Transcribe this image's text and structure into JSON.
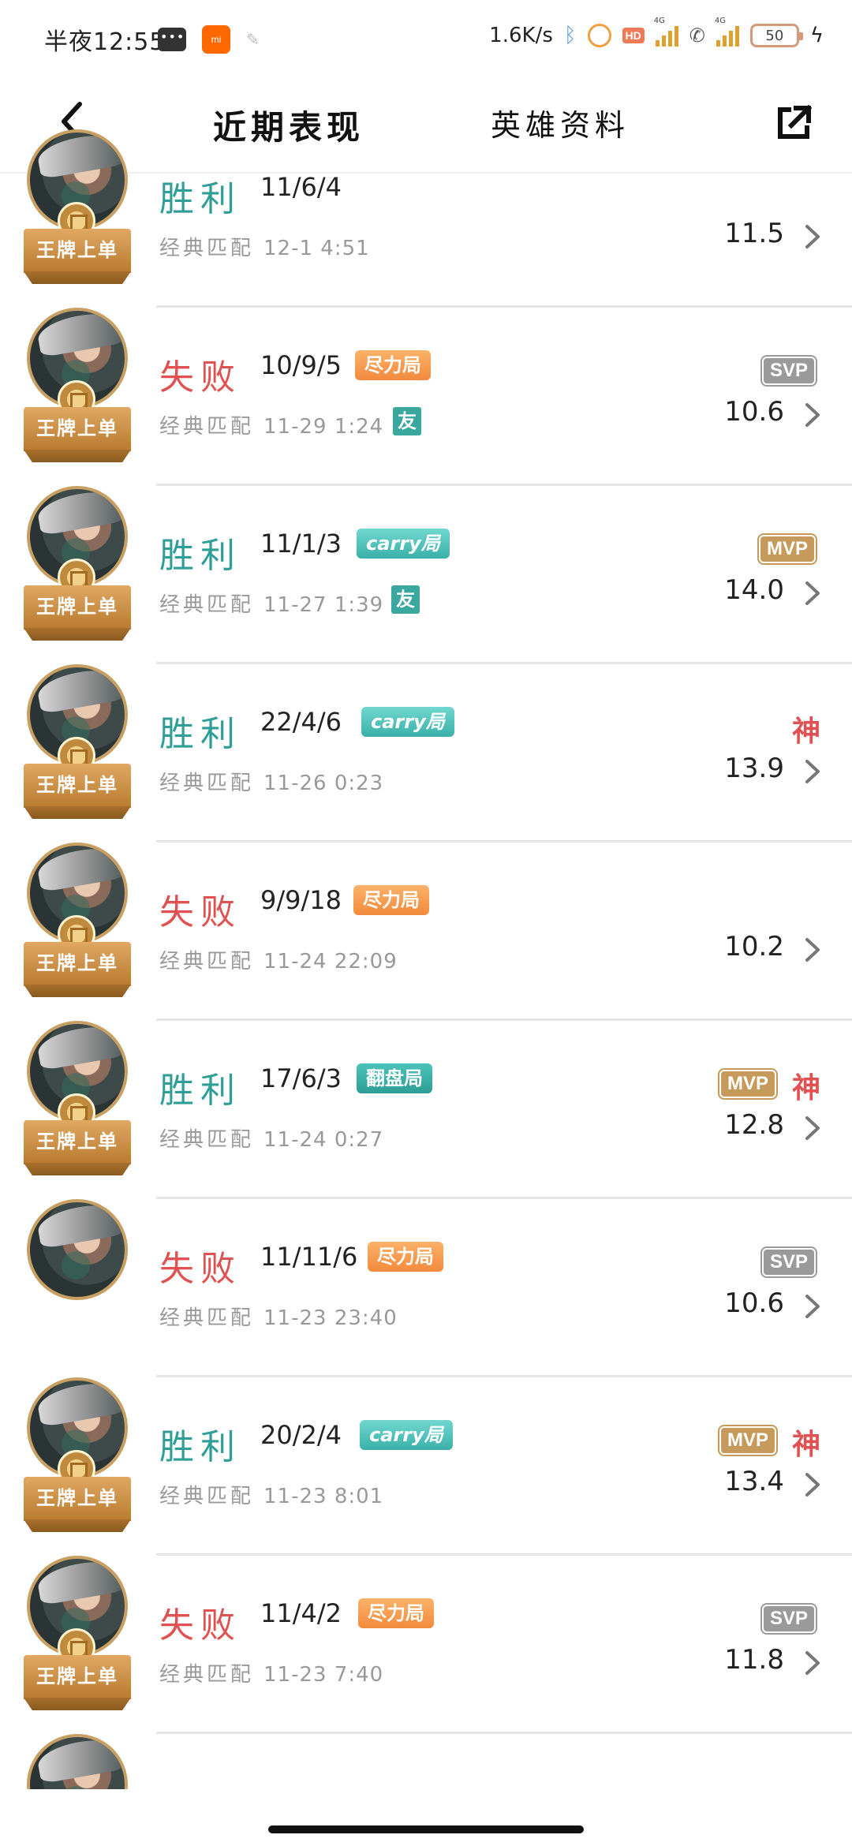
{
  "status_bar": {
    "time": "半夜12:55",
    "net_speed": "1.6K/s",
    "hd": "HD",
    "sig1_label": "4G",
    "sig2_label": "4G",
    "battery": "50"
  },
  "header": {
    "tab_recent": "近期表现",
    "tab_hero": "英雄资料"
  },
  "matches": [
    {
      "result": "胜利",
      "type": "win",
      "kda": "11/6/4",
      "tag": "",
      "tag_type": "",
      "mode": "经典匹配",
      "time": "12-1 4:51",
      "friend": "",
      "badge": "",
      "god": "",
      "score": "11.5",
      "ace": "王牌上单"
    },
    {
      "result": "失败",
      "type": "loss",
      "kda": "10/9/5",
      "tag": "尽力局",
      "tag_type": "effort",
      "mode": "经典匹配",
      "time": "11-29 1:24",
      "friend": "友",
      "badge": "SVP",
      "god": "",
      "score": "10.6",
      "ace": "王牌上单"
    },
    {
      "result": "胜利",
      "type": "win",
      "kda": "11/1/3",
      "tag": "carry局",
      "tag_type": "carry",
      "mode": "经典匹配",
      "time": "11-27 1:39",
      "friend": "友",
      "badge": "MVP",
      "god": "",
      "score": "14.0",
      "ace": "王牌上单"
    },
    {
      "result": "胜利",
      "type": "win",
      "kda": "22/4/6",
      "tag": "carry局",
      "tag_type": "carry",
      "mode": "经典匹配",
      "time": "11-26 0:23",
      "friend": "",
      "badge": "",
      "god": "神",
      "score": "13.9",
      "ace": "王牌上单"
    },
    {
      "result": "失败",
      "type": "loss",
      "kda": "9/9/18",
      "tag": "尽力局",
      "tag_type": "effort",
      "mode": "经典匹配",
      "time": "11-24 22:09",
      "friend": "",
      "badge": "",
      "god": "",
      "score": "10.2",
      "ace": "王牌上单"
    },
    {
      "result": "胜利",
      "type": "win",
      "kda": "17/6/3",
      "tag": "翻盘局",
      "tag_type": "comeback",
      "mode": "经典匹配",
      "time": "11-24 0:27",
      "friend": "",
      "badge": "MVP",
      "god": "神",
      "score": "12.8",
      "ace": "王牌上单"
    },
    {
      "result": "失败",
      "type": "loss",
      "kda": "11/11/6",
      "tag": "尽力局",
      "tag_type": "effort",
      "mode": "经典匹配",
      "time": "11-23 23:40",
      "friend": "",
      "badge": "SVP",
      "god": "",
      "score": "10.6",
      "ace": ""
    },
    {
      "result": "胜利",
      "type": "win",
      "kda": "20/2/4",
      "tag": "carry局",
      "tag_type": "carry",
      "mode": "经典匹配",
      "time": "11-23 8:01",
      "friend": "",
      "badge": "MVP",
      "god": "神",
      "score": "13.4",
      "ace": "王牌上单"
    },
    {
      "result": "失败",
      "type": "loss",
      "kda": "11/4/2",
      "tag": "尽力局",
      "tag_type": "effort",
      "mode": "经典匹配",
      "time": "11-23 7:40",
      "friend": "",
      "badge": "SVP",
      "god": "",
      "score": "11.8",
      "ace": "王牌上单"
    }
  ],
  "icons": {
    "back": "chevron-left-icon",
    "share": "share-icon",
    "row_arrow": "chevron-right-icon"
  },
  "colors": {
    "win": "#2f9e96",
    "loss": "#e05252",
    "effort_tag": "#f28a3c",
    "carry_tag": "#3ab0a8",
    "svp": "#9a9a9a",
    "mvp": "#c69a5a",
    "god": "#e05252",
    "ace_ribbon": "#c88a40"
  }
}
